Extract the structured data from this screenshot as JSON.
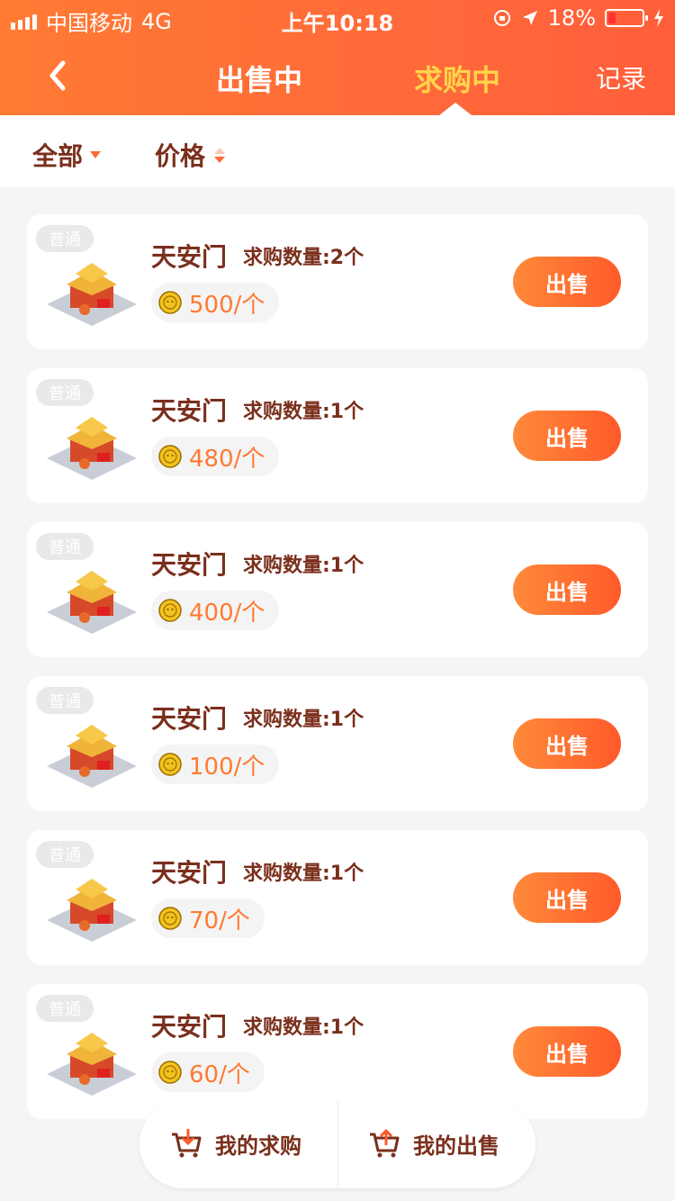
{
  "status_bar": {
    "carrier": "中国移动",
    "network": "4G",
    "time": "上午10:18",
    "battery": "18%"
  },
  "nav": {
    "tab_selling": "出售中",
    "tab_buying": "求购中",
    "record": "记录"
  },
  "filters": {
    "all": "全部",
    "price": "价格"
  },
  "items": [
    {
      "tag": "普通",
      "name": "天安门",
      "qty": "求购数量:2个",
      "price": "500/个",
      "action": "出售"
    },
    {
      "tag": "普通",
      "name": "天安门",
      "qty": "求购数量:1个",
      "price": "480/个",
      "action": "出售"
    },
    {
      "tag": "普通",
      "name": "天安门",
      "qty": "求购数量:1个",
      "price": "400/个",
      "action": "出售"
    },
    {
      "tag": "普通",
      "name": "天安门",
      "qty": "求购数量:1个",
      "price": "100/个",
      "action": "出售"
    },
    {
      "tag": "普通",
      "name": "天安门",
      "qty": "求购数量:1个",
      "price": "70/个",
      "action": "出售"
    },
    {
      "tag": "普通",
      "name": "天安门",
      "qty": "求购数量:1个",
      "price": "60/个",
      "action": "出售"
    }
  ],
  "bottom": {
    "my_buy": "我的求购",
    "my_sell": "我的出售"
  }
}
